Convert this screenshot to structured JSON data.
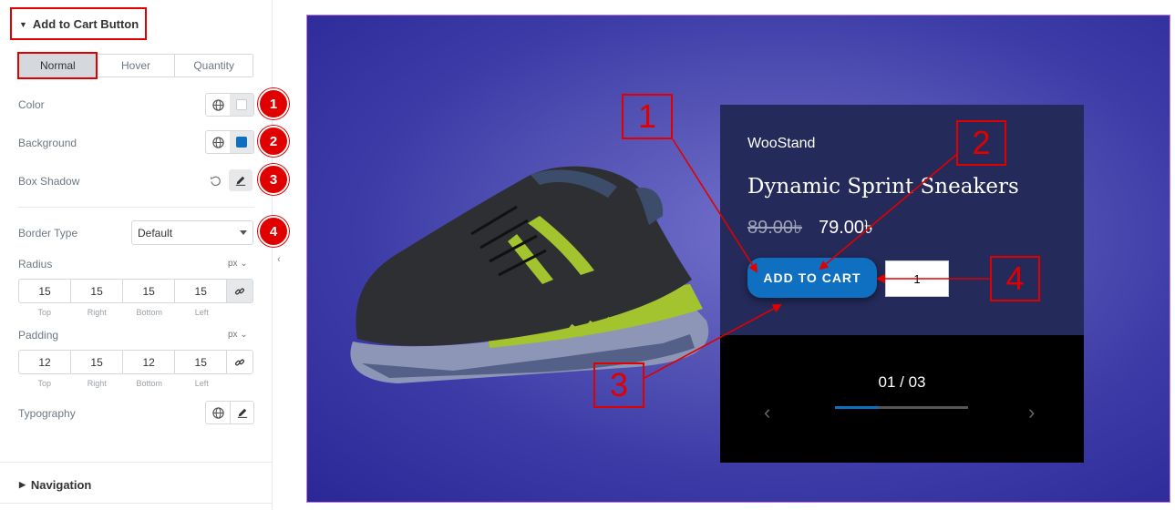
{
  "panel": {
    "section_title": "Add to Cart Button",
    "tabs": [
      {
        "label": "Normal",
        "active": true
      },
      {
        "label": "Hover",
        "active": false
      },
      {
        "label": "Quantity",
        "active": false
      }
    ],
    "color_label": "Color",
    "background_label": "Background",
    "box_shadow_label": "Box Shadow",
    "border_type_label": "Border Type",
    "border_type_value": "Default",
    "radius_label": "Radius",
    "radius_unit": "px",
    "radius_values": [
      "15",
      "15",
      "15",
      "15"
    ],
    "padding_label": "Padding",
    "padding_unit": "px",
    "padding_values": [
      "12",
      "15",
      "12",
      "15"
    ],
    "dim_labels": [
      "Top",
      "Right",
      "Bottom",
      "Left"
    ],
    "typography_label": "Typography",
    "navigation_title": "Navigation",
    "color_swatch": "#ffffff",
    "background_swatch": "#0f6fc0"
  },
  "badges": [
    "1",
    "2",
    "3",
    "4"
  ],
  "preview": {
    "brand": "WooStand",
    "product_name": "Dynamic Sprint Sneakers",
    "old_price": "89.00৳",
    "new_price": "79.00৳",
    "add_to_cart": "ADD TO CART",
    "quantity": "1",
    "counter": "01 / 03",
    "progress": 0.33
  },
  "callouts": [
    "1",
    "2",
    "3",
    "4"
  ],
  "colors": {
    "accent_red": "#e00000",
    "button_blue": "#0f6fc0",
    "card_bg": "#242a59"
  }
}
